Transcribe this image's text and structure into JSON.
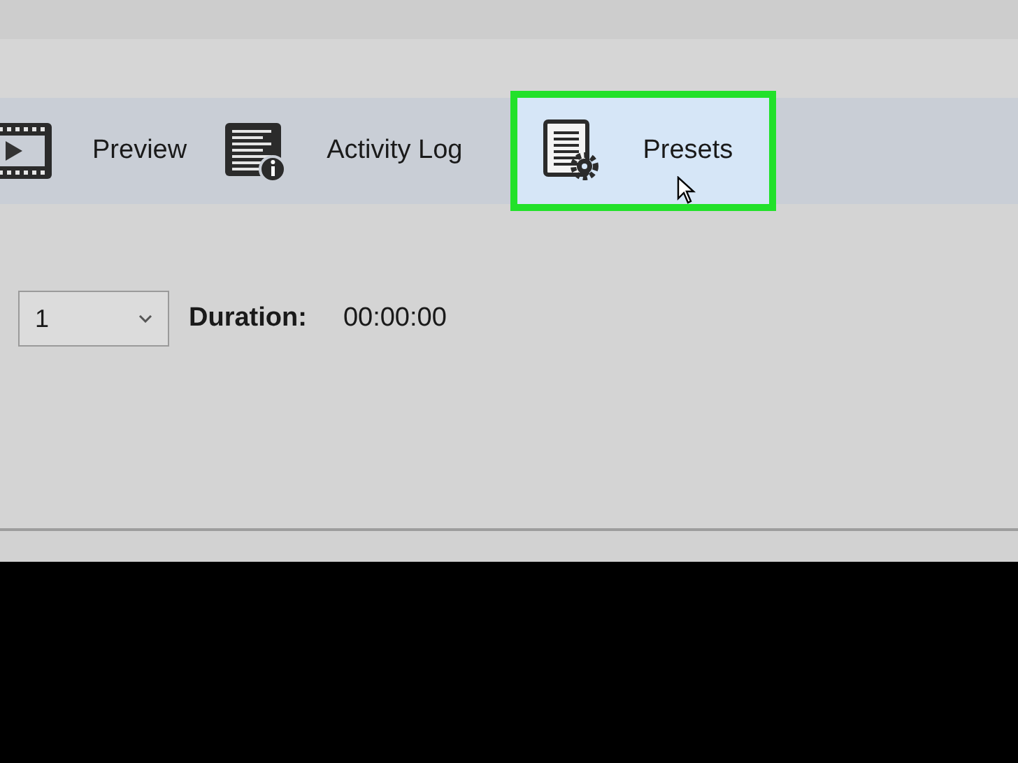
{
  "toolbar": {
    "items": [
      {
        "kind": "preview",
        "label": "Preview",
        "selected": false
      },
      {
        "kind": "log",
        "label": "Activity Log",
        "selected": false
      },
      {
        "kind": "presets",
        "label": "Presets",
        "selected": true
      }
    ]
  },
  "title_select": {
    "value": "1"
  },
  "duration": {
    "label": "Duration:",
    "value": "00:00:00"
  }
}
